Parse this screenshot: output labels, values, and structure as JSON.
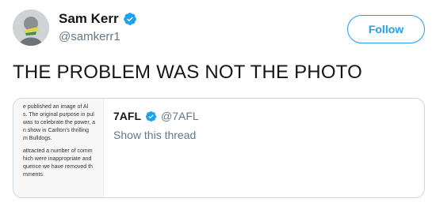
{
  "author": {
    "display_name": "Sam Kerr",
    "handle": "@samkerr1",
    "verified_icon": "verified-badge-icon"
  },
  "follow_button": {
    "label": "Follow"
  },
  "tweet": {
    "text": "THE PROBLEM WAS NOT THE PHOTO"
  },
  "quoted_tweet": {
    "display_name": "7AFL",
    "handle": "@7AFL",
    "show_thread": "Show this thread",
    "image_text": {
      "paragraph_1": [
        "e published an image of Al",
        "s. The original purpose in pul",
        "was to celebrate the power, a",
        "n show in Carlton's thrilling",
        "m Bulldogs."
      ],
      "paragraph_2": [
        "attracted a number of comm",
        "hich were inappropriate and",
        "quence we have removed th",
        "mments."
      ]
    }
  },
  "colors": {
    "accent": "#1da1f2",
    "secondary_text": "#657786",
    "primary_text": "#14171a",
    "border": "#ccd6dd"
  }
}
